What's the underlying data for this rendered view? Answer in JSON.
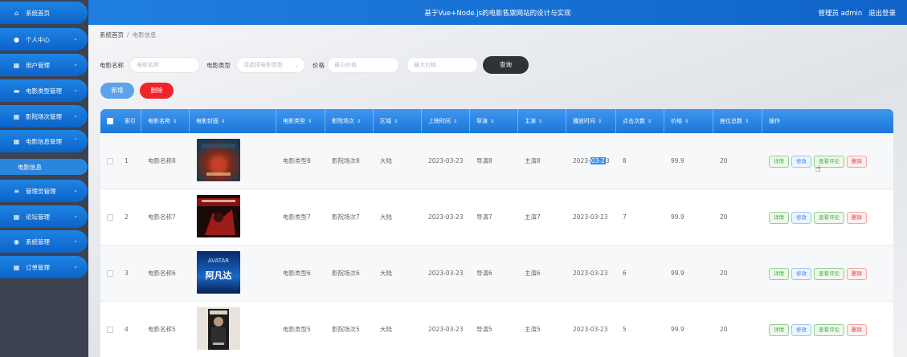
{
  "sidebar": {
    "items": [
      {
        "label": "系统首页",
        "icon": "home-icon"
      },
      {
        "label": "个人中心",
        "icon": "person-icon"
      },
      {
        "label": "用户管理",
        "icon": "grid-icon"
      },
      {
        "label": "电影类型管理",
        "icon": "film-icon"
      },
      {
        "label": "影院场次管理",
        "icon": "grid-icon"
      },
      {
        "label": "电影信息管理",
        "icon": "grid-icon",
        "expanded": true
      },
      {
        "label": "管理员管理",
        "icon": "list-icon"
      },
      {
        "label": "论坛管理",
        "icon": "grid-icon"
      },
      {
        "label": "系统管理",
        "icon": "location-icon"
      },
      {
        "label": "订单管理",
        "icon": "grid-icon"
      }
    ],
    "active_sub": "电影信息"
  },
  "header": {
    "title": "基于Vue+Node.js的电影售票网站的设计与实现",
    "role": "管理员 admin",
    "logout": "退出登录"
  },
  "breadcrumb": {
    "home": "系统首页",
    "current": "电影信息"
  },
  "search": {
    "name_label": "电影名称",
    "name_placeholder": "电影名称",
    "type_label": "电影类型",
    "type_placeholder": "请选择电影类型",
    "price_label": "价格",
    "min_price_placeholder": "最小价格",
    "max_price_placeholder": "最大价格",
    "query_label": "查询"
  },
  "actions": {
    "add": "新增",
    "delete": "删除"
  },
  "table": {
    "columns": [
      "索引",
      "电影名称",
      "电影封面",
      "电影类型",
      "影院场次",
      "区域",
      "上映时间",
      "导演",
      "主演",
      "播放时间",
      "点击次数",
      "价格",
      "座位总数",
      "操作"
    ],
    "rows": [
      {
        "index": "1",
        "name": "电影名称8",
        "poster": "poster-8",
        "type": "电影类型8",
        "session": "影院场次8",
        "region": "大陆",
        "release": "2023-03-23",
        "director": "导演8",
        "actor": "主演8",
        "play_prefix": "2023-",
        "play_highlight": "03-2",
        "play_suffix": "3",
        "clicks": "8",
        "price": "99.9",
        "seats": "20"
      },
      {
        "index": "2",
        "name": "电影名称7",
        "poster": "poster-7",
        "type": "电影类型7",
        "session": "影院场次7",
        "region": "大陆",
        "release": "2023-03-23",
        "director": "导演7",
        "actor": "主演7",
        "play": "2023-03-23",
        "clicks": "7",
        "price": "99.9",
        "seats": "20"
      },
      {
        "index": "3",
        "name": "电影名称6",
        "poster": "poster-avatar",
        "type": "电影类型6",
        "session": "影院场次6",
        "region": "大陆",
        "release": "2023-03-23",
        "director": "导演6",
        "actor": "主演6",
        "play": "2023-03-23",
        "clicks": "6",
        "price": "99.9",
        "seats": "20"
      },
      {
        "index": "4",
        "name": "电影名称5",
        "poster": "poster-5",
        "type": "电影类型5",
        "session": "影院场次5",
        "region": "大陆",
        "release": "2023-03-23",
        "director": "导演5",
        "actor": "主演5",
        "play": "2023-03-23",
        "clicks": "5",
        "price": "99.9",
        "seats": "20"
      }
    ],
    "row_actions": {
      "detail": "详情",
      "edit": "修改",
      "review": "查看评论",
      "remove": "删除"
    },
    "poster_texts": {
      "avatar_en": "AVATAR",
      "avatar_cn": "阿凡达"
    }
  },
  "colors": {
    "primary": "#1a76d9",
    "danger": "#f0242a",
    "sidebar_bg": "#3d4250"
  }
}
